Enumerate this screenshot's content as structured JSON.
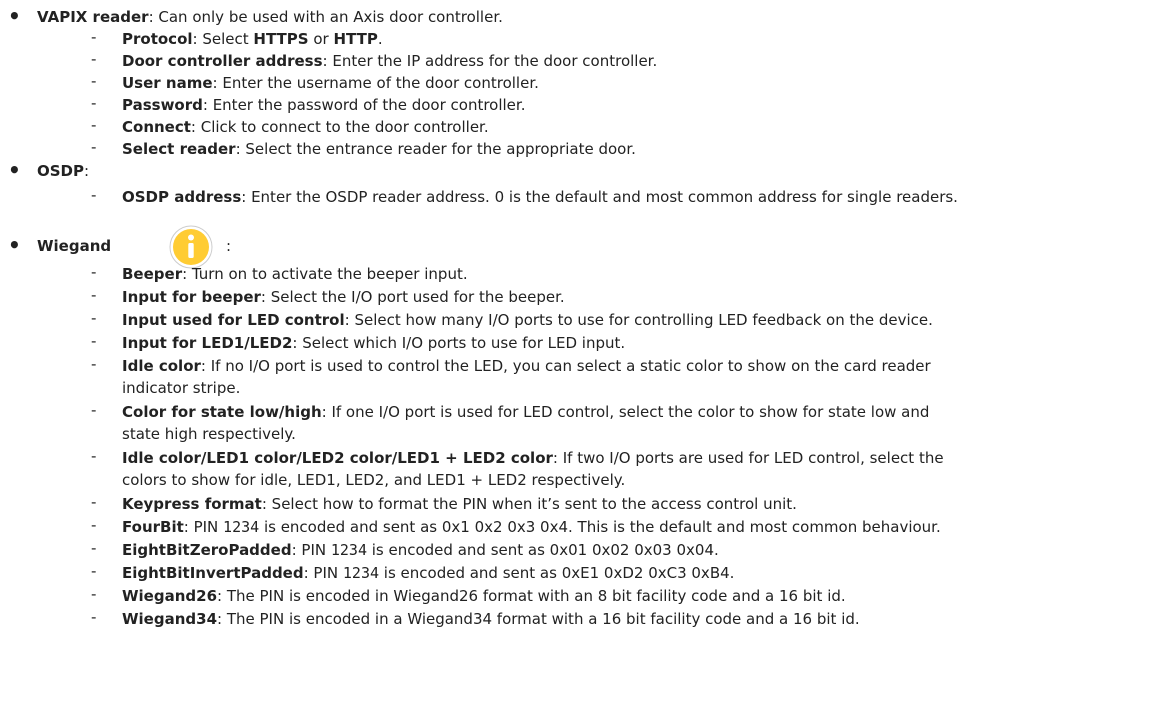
{
  "vapix": {
    "term": "VAPIX reader",
    "desc": ": Can only be used with an Axis door controller.",
    "items": [
      {
        "term": "Protocol",
        "d1": ": Select ",
        "b1": "HTTPS",
        "d2": " or ",
        "b2": "HTTP",
        "d3": "."
      },
      {
        "term": "Door controller address",
        "desc": ": Enter the IP address for the door controller."
      },
      {
        "term": "User name",
        "desc": ": Enter the username of the door controller."
      },
      {
        "term": "Password",
        "desc": ": Enter the password of the door controller."
      },
      {
        "term": "Connect",
        "desc": ": Click to connect to the door controller."
      },
      {
        "term": "Select reader",
        "desc": ": Select the entrance reader for the appropriate door."
      }
    ]
  },
  "osdp": {
    "term": "OSDP",
    "desc": ":",
    "items": [
      {
        "term": "OSDP address",
        "desc": ": Enter the OSDP reader address. 0 is the default and most common address for single readers."
      }
    ]
  },
  "wiegand": {
    "term": "Wiegand",
    "desc": ":",
    "icon": "info-icon",
    "icon_color": "#FFCC33",
    "items": [
      {
        "term": "Beeper",
        "desc": ": Turn on to activate the beeper input."
      },
      {
        "term": "Input for beeper",
        "desc": ": Select the I/O port used for the beeper."
      },
      {
        "term": "Input used for LED control",
        "desc": ": Select how many I/O ports to use for controlling LED feedback on the device."
      },
      {
        "term": "Input for LED1/LED2",
        "desc": ": Select which I/O ports to use for LED input."
      },
      {
        "term": "Idle color",
        "desc": ": If no I/O port is used to control the LED, you can select a static color to show on the card reader",
        "cont": "indicator stripe."
      },
      {
        "term": "Color for state low/high",
        "desc": ": If one I/O port is used for LED control, select the color to show for state low and",
        "cont": "state high respectively."
      },
      {
        "term": "Idle color/LED1 color/LED2 color/LED1 + LED2 color",
        "desc": ": If two I/O ports are used for LED control, select the",
        "cont": "colors to show for idle, LED1, LED2, and LED1 + LED2 respectively."
      },
      {
        "term": "Keypress format",
        "desc": ": Select how to format the PIN when it’s sent to the access control unit."
      },
      {
        "term": "FourBit",
        "d1": ": PIN ",
        "code": "1234",
        "d2": " is encoded and sent as 0x1 0x2 0x3 0x4. This is the default and most common behaviour."
      },
      {
        "term": "EightBitZeroPadded",
        "d1": ": PIN ",
        "code": "1234",
        "d2": " is encoded and sent as 0x01 0x02 0x03 0x04."
      },
      {
        "term": "EightBitInvertPadded",
        "d1": ": PIN ",
        "code": "1234",
        "d2": " is encoded and sent as 0xE1 0xD2 0xC3 0xB4."
      },
      {
        "term": "Wiegand26",
        "desc": ": The PIN is encoded in Wiegand26 format with an 8 bit facility code and a 16 bit id."
      },
      {
        "term": "Wiegand34",
        "desc": ": The PIN is encoded in a Wiegand34 format with a 16 bit facility code and a 16 bit id."
      }
    ]
  }
}
